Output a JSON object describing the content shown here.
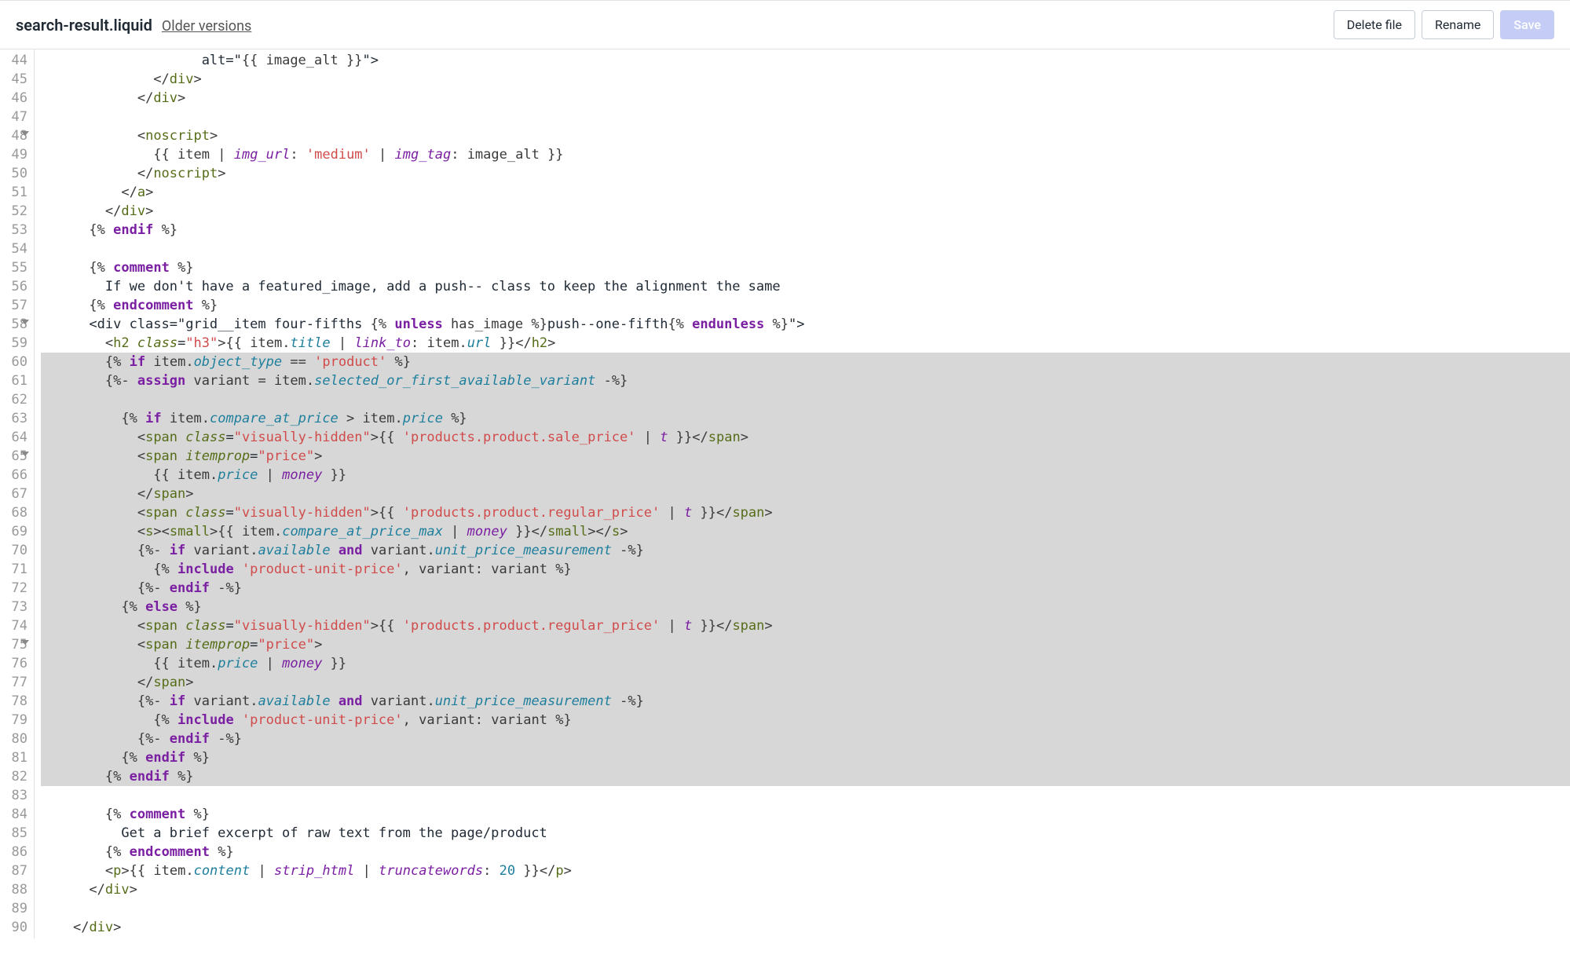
{
  "header": {
    "filename": "search-result.liquid",
    "older_versions": "Older versions",
    "buttons": {
      "delete": "Delete file",
      "rename": "Rename",
      "save": "Save"
    }
  },
  "editor": {
    "first_line_number": 44,
    "last_line_number": 90,
    "fold_lines": [
      48,
      58,
      65,
      75
    ],
    "highlight_start": 60,
    "highlight_end": 82,
    "lines": [
      "                    alt=\"{{ image_alt }}\">",
      "              </div>",
      "            </div>",
      "",
      "            <noscript>",
      "              {{ item | img_url: 'medium' | img_tag: image_alt }}",
      "            </noscript>",
      "          </a>",
      "        </div>",
      "      {% endif %}",
      "",
      "      {% comment %}",
      "        If we don't have a featured_image, add a push-- class to keep the alignment the same",
      "      {% endcomment %}",
      "      <div class=\"grid__item four-fifths {% unless has_image %}push--one-fifth{% endunless %}\">",
      "        <h2 class=\"h3\">{{ item.title | link_to: item.url }}</h2>",
      "        {% if item.object_type == 'product' %}",
      "        {%- assign variant = item.selected_or_first_available_variant -%}",
      "",
      "          {% if item.compare_at_price > item.price %}",
      "            <span class=\"visually-hidden\">{{ 'products.product.sale_price' | t }}</span>",
      "            <span itemprop=\"price\">",
      "              {{ item.price | money }}",
      "            </span>",
      "            <span class=\"visually-hidden\">{{ 'products.product.regular_price' | t }}</span>",
      "            <s><small>{{ item.compare_at_price_max | money }}</small></s>",
      "            {%- if variant.available and variant.unit_price_measurement -%}",
      "              {% include 'product-unit-price', variant: variant %}",
      "            {%- endif -%}",
      "          {% else %}",
      "            <span class=\"visually-hidden\">{{ 'products.product.regular_price' | t }}</span>",
      "            <span itemprop=\"price\">",
      "              {{ item.price | money }}",
      "            </span>",
      "            {%- if variant.available and variant.unit_price_measurement -%}",
      "              {% include 'product-unit-price', variant: variant %}",
      "            {%- endif -%}",
      "          {% endif %}",
      "        {% endif %}",
      "",
      "        {% comment %}",
      "          Get a brief excerpt of raw text from the page/product",
      "        {% endcomment %}",
      "        <p>{{ item.content | strip_html | truncatewords: 20 }}</p>",
      "      </div>",
      "",
      "    </div>"
    ]
  }
}
